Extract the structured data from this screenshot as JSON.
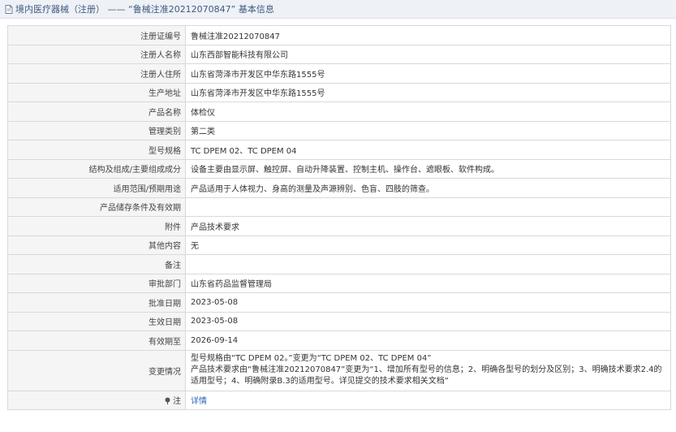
{
  "header": {
    "title": "境内医疗器械（注册） —— “鲁械注准20212070847” 基本信息"
  },
  "rows": [
    {
      "label": "注册证编号",
      "value": "鲁械注准20212070847"
    },
    {
      "label": "注册人名称",
      "value": "山东西部智能科技有限公司"
    },
    {
      "label": "注册人住所",
      "value": "山东省菏泽市开发区中华东路1555号"
    },
    {
      "label": "生产地址",
      "value": "山东省菏泽市开发区中华东路1555号"
    },
    {
      "label": "产品名称",
      "value": "体检仪"
    },
    {
      "label": "管理类别",
      "value": "第二类"
    },
    {
      "label": "型号规格",
      "value": "TC DPEM 02、TC DPEM 04"
    },
    {
      "label": "结构及组成/主要组成成分",
      "value": "设备主要由显示屏、触控屏、自动升降装置、控制主机、操作台、遮眼板、软件构成。"
    },
    {
      "label": "适用范围/预期用途",
      "value": "产品适用于人体视力、身高的测量及声源辨别、色盲、四肢的筛查。"
    },
    {
      "label": "产品储存条件及有效期",
      "value": ""
    },
    {
      "label": "附件",
      "value": "产品技术要求"
    },
    {
      "label": "其他内容",
      "value": "无"
    },
    {
      "label": "备注",
      "value": ""
    },
    {
      "label": "审批部门",
      "value": "山东省药品监督管理局"
    },
    {
      "label": "批准日期",
      "value": "2023-05-08"
    },
    {
      "label": "生效日期",
      "value": "2023-05-08"
    },
    {
      "label": "有效期至",
      "value": "2026-09-14"
    }
  ],
  "change": {
    "label": "变更情况",
    "lines": [
      "型号规格由“TC DPEM 02。”变更为“TC DPEM 02、TC DPEM 04”",
      "产品技术要求由“鲁械注准20212070847”变更为“1、增加所有型号的信息；2、明确各型号的划分及区别；3、明确技术要求2.4的",
      "适用型号；4、明确附录B.3的适用型号。详见提交的技术要求相关文档”"
    ]
  },
  "note": {
    "label": "注",
    "link": "详情"
  }
}
